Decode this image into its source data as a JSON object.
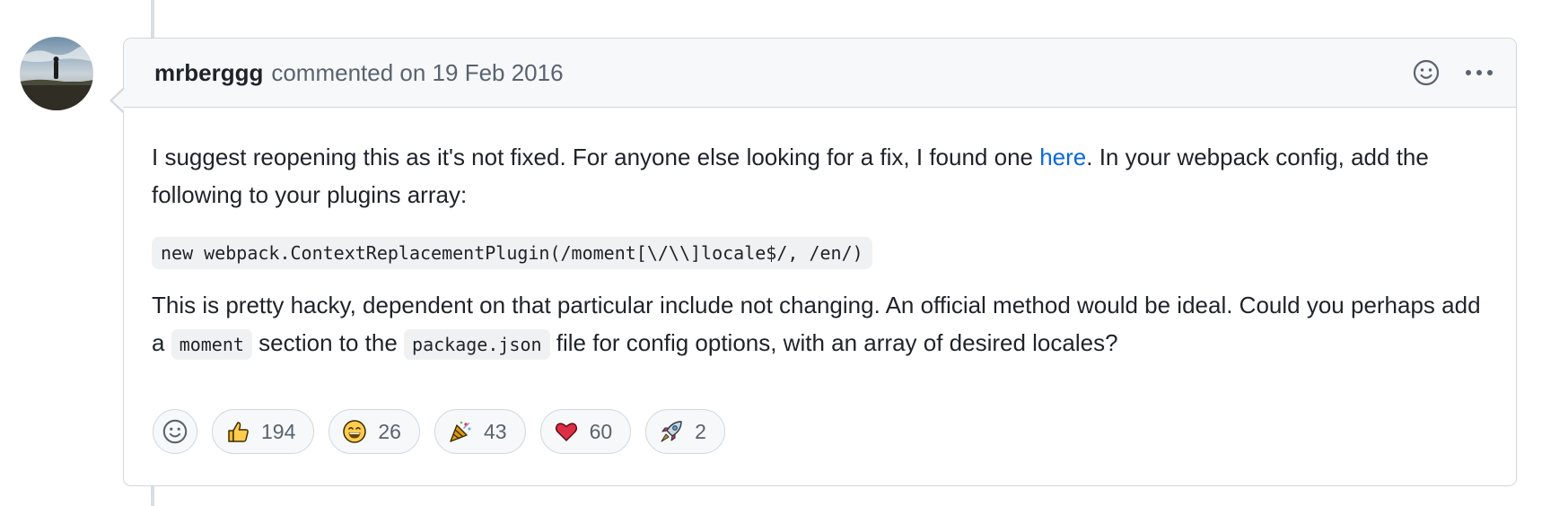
{
  "comment": {
    "author": "mrberggg",
    "meta": "commented on 19 Feb 2016",
    "body": {
      "p1_before": "I suggest reopening this as it's not fixed. For anyone else looking for a fix, I found one ",
      "p1_link": "here",
      "p1_after": ". In your webpack config, add the following to your plugins array:",
      "code": "new webpack.ContextReplacementPlugin(/moment[\\/\\\\]locale$/, /en/)",
      "p2_a": "This is pretty hacky, dependent on that particular include not changing. An official method would be ideal. Could you perhaps add a ",
      "p2_code1": "moment",
      "p2_b": " section to the ",
      "p2_code2": "package.json",
      "p2_c": " file for config options, with an array of desired locales?"
    }
  },
  "reactions": [
    {
      "emoji": "thumbs-up-icon",
      "count": "194"
    },
    {
      "emoji": "laugh-icon",
      "count": "26"
    },
    {
      "emoji": "hooray-icon",
      "count": "43"
    },
    {
      "emoji": "heart-icon",
      "count": "60"
    },
    {
      "emoji": "rocket-icon",
      "count": "2"
    }
  ],
  "colors": {
    "link": "#0969da",
    "border": "#d0d7de",
    "header_bg": "#f6f8fa",
    "muted_text": "#59636e"
  }
}
